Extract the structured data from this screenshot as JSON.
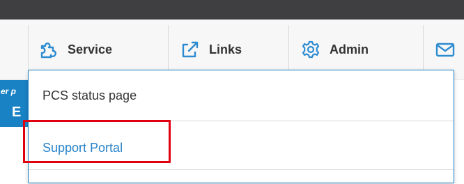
{
  "top_bar": {},
  "nav": {
    "items": [
      {
        "label": "Service",
        "icon": "puzzle-icon"
      },
      {
        "label": "Links",
        "icon": "external-link-icon"
      },
      {
        "label": "Admin",
        "icon": "gear-icon"
      },
      {
        "label": "",
        "icon": "mail-icon"
      }
    ]
  },
  "banner": {
    "text_fragment_small": "er p",
    "text_fragment_big": "E"
  },
  "dropdown": {
    "items": [
      {
        "label": "PCS status page"
      },
      {
        "label": "Support Portal"
      },
      {
        "label": ""
      }
    ]
  },
  "colors": {
    "top_bar": "#3f3f41",
    "nav_background": "#f7f7f7",
    "link_blue": "#2a84c9",
    "banner_blue": "#1982c4",
    "highlight_red": "#e10010"
  }
}
